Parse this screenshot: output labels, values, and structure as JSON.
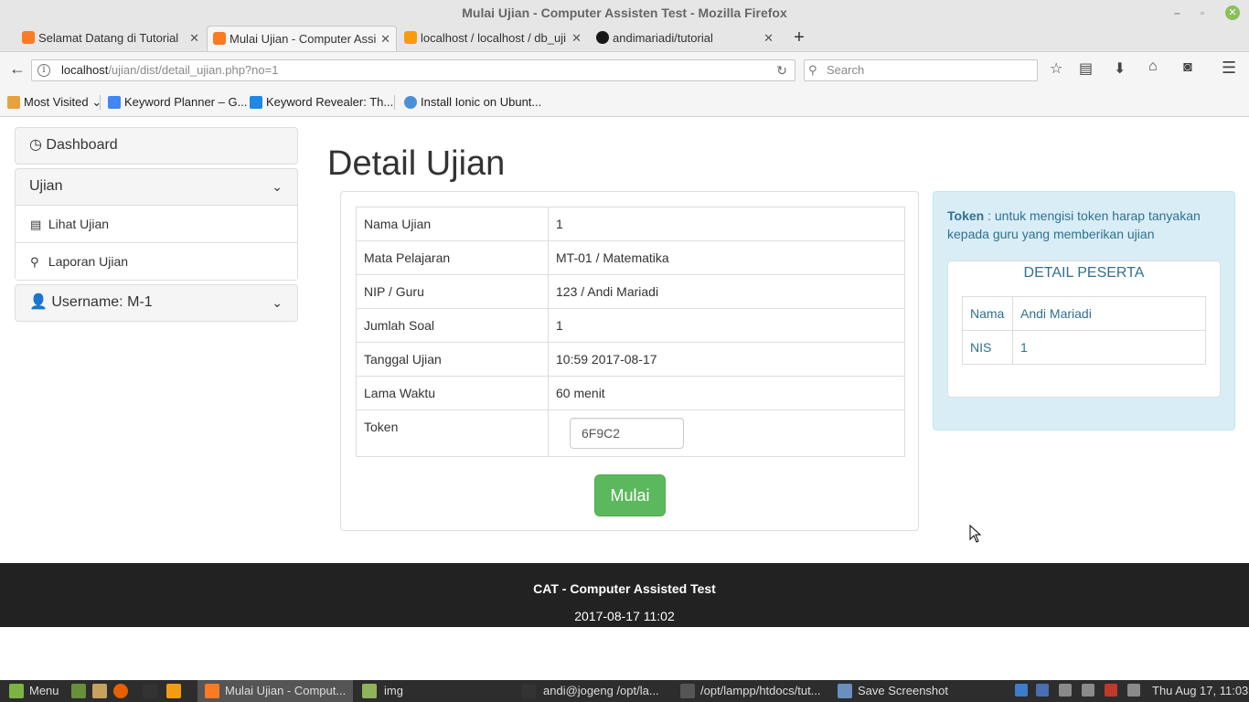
{
  "window": {
    "title": "Mulai Ujian - Computer Assisten Test - Mozilla Firefox",
    "minimize": "–",
    "maximize": "▫",
    "close": "✕"
  },
  "tabs": [
    {
      "label": "Selamat Datang di Tutorial",
      "icon": "xampp-icon",
      "color": "#fb7a24"
    },
    {
      "label": "Mulai Ujian - Computer Assi",
      "icon": "xampp-icon",
      "color": "#fb7a24"
    },
    {
      "label": "localhost / localhost / db_uji",
      "icon": "phpmyadmin-icon",
      "color": "#f89c0e"
    },
    {
      "label": "andimariadi/tutorial",
      "icon": "github-icon",
      "color": "#181717"
    }
  ],
  "nav": {
    "url_host": "localhost",
    "url_path": "/ujian/dist/detail_ujian.php?no=1",
    "search_placeholder": "Search"
  },
  "bookmarks": [
    {
      "label": "Most Visited",
      "icon": "most-visited-icon",
      "color": "#e6a23c",
      "dropdown": "⌄"
    },
    {
      "label": "Keyword Planner – G...",
      "icon": "adwords-icon",
      "color": "#4285f4"
    },
    {
      "label": "Keyword Revealer: Th...",
      "icon": "keyword-revealer-icon",
      "color": "#1e88e5"
    },
    {
      "label": "Install Ionic on Ubunt...",
      "icon": "chrome-icon",
      "color": "#4a90d9"
    }
  ],
  "sidebar": {
    "dashboard": "Dashboard",
    "ujian": "Ujian",
    "lihat_ujian": "Lihat Ujian",
    "laporan_ujian": "Laporan Ujian",
    "username": "Username: M-1"
  },
  "main": {
    "title": "Detail Ujian",
    "rows": [
      {
        "label": "Nama Ujian",
        "value": "1"
      },
      {
        "label": "Mata Pelajaran",
        "value": "MT-01 / Matematika"
      },
      {
        "label": "NIP / Guru",
        "value": "123 / Andi Mariadi"
      },
      {
        "label": "Jumlah Soal",
        "value": "1"
      },
      {
        "label": "Tanggal Ujian",
        "value": "10:59 2017-08-17"
      },
      {
        "label": "Lama Waktu",
        "value": "60 menit"
      }
    ],
    "token_label": "Token",
    "token_value": "6F9C2",
    "start_button": "Mulai"
  },
  "info": {
    "token_bold": "Token",
    "token_text": " : untuk mengisi token harap tanyakan kepada guru yang memberikan ujian",
    "detail_title": "DETAIL PESERTA",
    "rows": [
      {
        "label": "Nama",
        "value": "Andi Mariadi"
      },
      {
        "label": "NIS",
        "value": "1"
      }
    ]
  },
  "footer": {
    "app_name": "CAT - Computer Assisted Test",
    "datetime": "2017-08-17 11:02"
  },
  "taskbar": {
    "menu": "Menu",
    "tasks": [
      {
        "label": "Mulai Ujian - Comput...",
        "active": true
      },
      {
        "label": "img",
        "active": false
      },
      {
        "label": "andi@jogeng /opt/la...",
        "active": false
      },
      {
        "label": "/opt/lampp/htdocs/tut...",
        "active": false
      },
      {
        "label": "Save Screenshot",
        "active": false
      }
    ],
    "clock": "Thu Aug 17, 11:03"
  },
  "colors": {
    "primary_button": "#5cb85c",
    "info_bg": "#d9edf7",
    "info_text": "#31708f",
    "footer_bg": "#222222"
  }
}
